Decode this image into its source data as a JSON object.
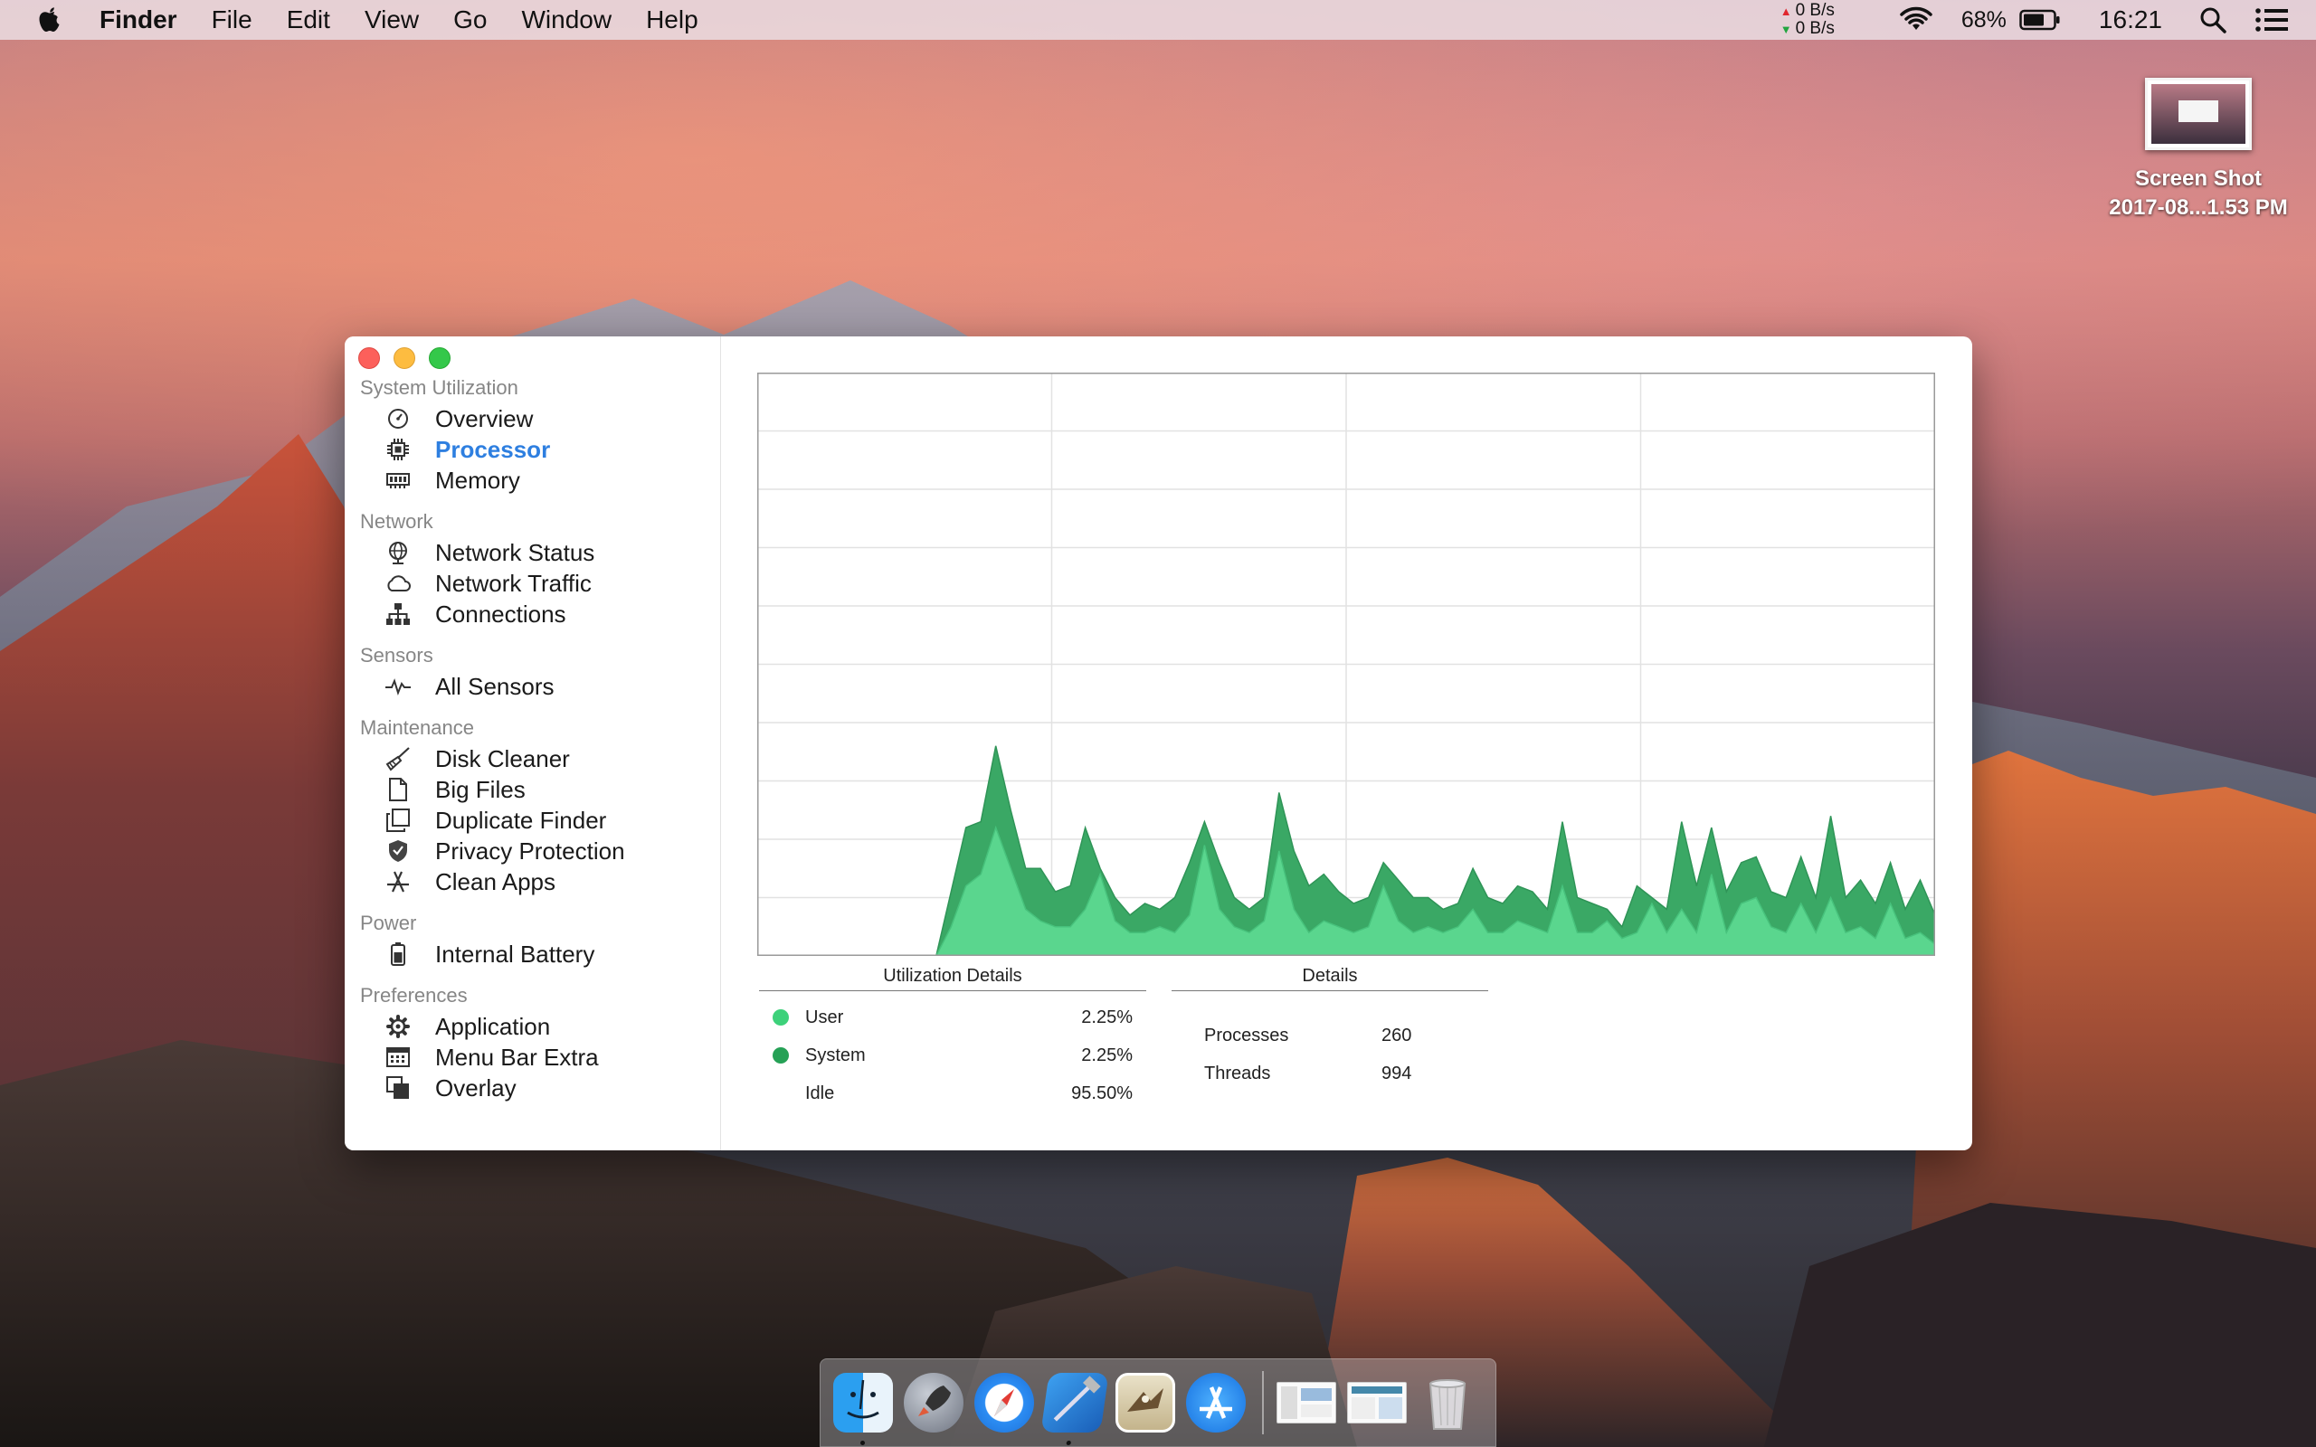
{
  "menubar": {
    "app_name": "Finder",
    "menus": [
      "File",
      "Edit",
      "View",
      "Go",
      "Window",
      "Help"
    ],
    "net_up": "0 B/s",
    "net_down": "0 B/s",
    "battery": "68%",
    "clock": "16:21",
    "icons": [
      "apple-icon",
      "wifi-icon",
      "battery-icon",
      "spotlight-icon",
      "notification-center-icon"
    ]
  },
  "desktop": {
    "file_name_line1": "Screen Shot",
    "file_name_line2": "2017-08...1.53 PM"
  },
  "sidebar": {
    "sections": [
      {
        "title": "System Utilization",
        "items": [
          {
            "label": "Overview",
            "icon": "gauge-icon"
          },
          {
            "label": "Processor",
            "icon": "cpu-icon",
            "active": true
          },
          {
            "label": "Memory",
            "icon": "memory-icon"
          }
        ]
      },
      {
        "title": "Network",
        "items": [
          {
            "label": "Network Status",
            "icon": "globe-icon"
          },
          {
            "label": "Network Traffic",
            "icon": "cloud-icon"
          },
          {
            "label": "Connections",
            "icon": "hierarchy-icon"
          }
        ]
      },
      {
        "title": "Sensors",
        "items": [
          {
            "label": "All Sensors",
            "icon": "pulse-icon"
          }
        ]
      },
      {
        "title": "Maintenance",
        "items": [
          {
            "label": "Disk Cleaner",
            "icon": "broom-icon"
          },
          {
            "label": "Big Files",
            "icon": "document-icon"
          },
          {
            "label": "Duplicate Finder",
            "icon": "copy-icon"
          },
          {
            "label": "Privacy Protection",
            "icon": "shield-icon"
          },
          {
            "label": "Clean Apps",
            "icon": "app-store-icon"
          }
        ]
      },
      {
        "title": "Power",
        "items": [
          {
            "label": "Internal Battery",
            "icon": "battery-icon"
          }
        ]
      },
      {
        "title": "Preferences",
        "items": [
          {
            "label": "Application",
            "icon": "gear-icon"
          },
          {
            "label": "Menu Bar Extra",
            "icon": "menubar-icon"
          },
          {
            "label": "Overlay",
            "icon": "overlay-icon"
          }
        ]
      }
    ]
  },
  "utilization": {
    "title": "Utilization Details",
    "rows": [
      {
        "label": "User",
        "value": "2.25%",
        "color": "#3dd17a"
      },
      {
        "label": "System",
        "value": "2.25%",
        "color": "#26a156"
      },
      {
        "label": "Idle",
        "value": "95.50%",
        "color": ""
      }
    ]
  },
  "details": {
    "title": "Details",
    "rows": [
      {
        "label": "Processes",
        "value": "260"
      },
      {
        "label": "Threads",
        "value": "994"
      }
    ]
  },
  "chart_data": {
    "type": "area",
    "colors": {
      "user": "#5ad68e",
      "system": "#3aa865",
      "grid": "#e2e2e2"
    },
    "grid": true,
    "ylim": [
      0,
      100
    ],
    "x": [
      0,
      1,
      2,
      3,
      4,
      5,
      6,
      7,
      8,
      9,
      10,
      11,
      12,
      13,
      14,
      15,
      16,
      17,
      18,
      19,
      20,
      21,
      22,
      23,
      24,
      25,
      26,
      27,
      28,
      29,
      30,
      31,
      32,
      33,
      34,
      35,
      36,
      37,
      38,
      39,
      40,
      41,
      42,
      43,
      44,
      45,
      46,
      47,
      48,
      49,
      50,
      51,
      52,
      53,
      54,
      55,
      56,
      57,
      58,
      59,
      60,
      61,
      62,
      63,
      64,
      65,
      66,
      67,
      68,
      69,
      70,
      71,
      72,
      73,
      74,
      75,
      76,
      77,
      78,
      79
    ],
    "series": [
      {
        "key": "user",
        "values": [
          0,
          0,
          0,
          0,
          0,
          0,
          0,
          0,
          0,
          0,
          0,
          0,
          0,
          5,
          12,
          14,
          22,
          15,
          8,
          6,
          5,
          5,
          8,
          14,
          6,
          4,
          4,
          5,
          4,
          7,
          19,
          8,
          5,
          4,
          6,
          18,
          8,
          4,
          6,
          5,
          4,
          5,
          12,
          6,
          4,
          5,
          4,
          5,
          8,
          4,
          4,
          6,
          5,
          4,
          12,
          4,
          4,
          6,
          3,
          4,
          9,
          4,
          8,
          4,
          14,
          4,
          9,
          10,
          5,
          4,
          9,
          4,
          10,
          4,
          5,
          3,
          9,
          3,
          4,
          2
        ]
      },
      {
        "key": "system",
        "values": [
          0,
          0,
          0,
          0,
          0,
          0,
          0,
          0,
          0,
          0,
          0,
          0,
          0,
          11,
          22,
          23,
          36,
          25,
          15,
          15,
          11,
          12,
          22,
          15,
          10,
          7,
          9,
          8,
          10,
          16,
          23,
          16,
          10,
          8,
          10,
          28,
          18,
          12,
          14,
          11,
          9,
          10,
          16,
          13,
          10,
          10,
          8,
          9,
          15,
          10,
          9,
          12,
          11,
          8,
          23,
          10,
          9,
          8,
          5,
          12,
          10,
          8,
          23,
          12,
          22,
          11,
          16,
          17,
          11,
          10,
          17,
          10,
          24,
          10,
          13,
          9,
          16,
          8,
          13,
          7
        ]
      }
    ]
  },
  "dock": {
    "apps": [
      "finder-icon",
      "launchpad-icon",
      "safari-icon",
      "xcode-icon",
      "mail-icon",
      "app-store-icon",
      "screenshot-thumb-icon",
      "screenshot-thumb-icon",
      "trash-icon"
    ]
  }
}
